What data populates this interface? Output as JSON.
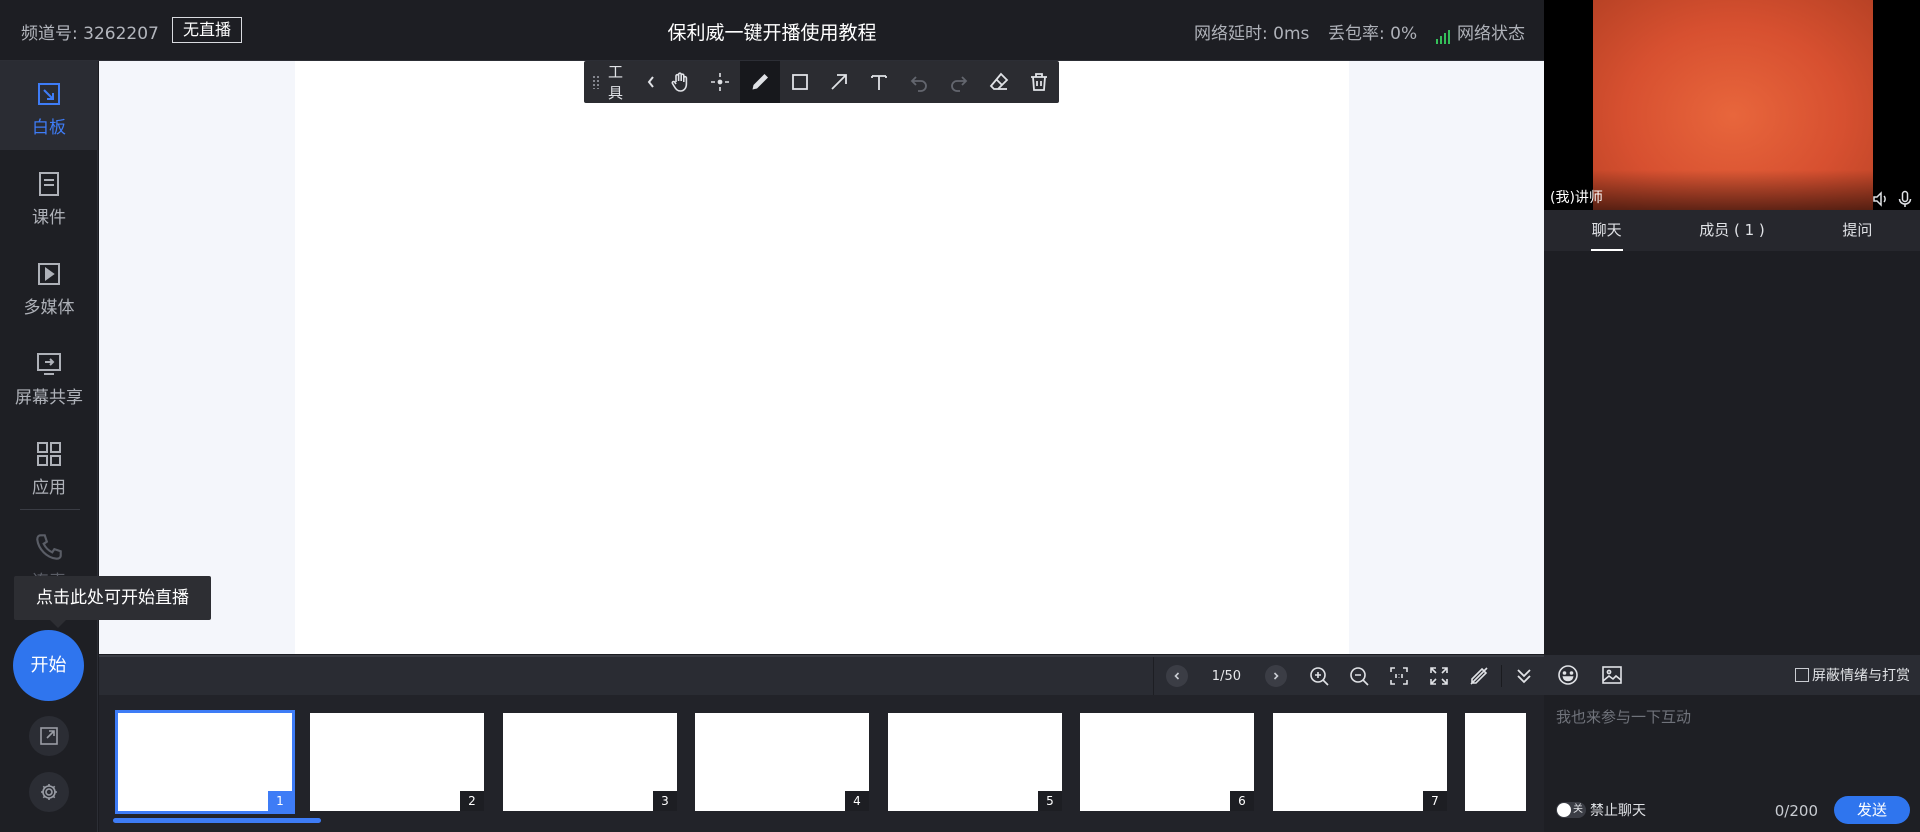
{
  "topbar": {
    "channel": "频道号: 3262207",
    "live_status": "无直播",
    "title": "保利威一键开播使用教程",
    "latency": "网络延时: 0ms",
    "packet_loss": "丢包率: 0%",
    "network_status": "网络状态"
  },
  "sidebar": {
    "items": [
      {
        "label": "白板",
        "icon": "whiteboard-icon"
      },
      {
        "label": "课件",
        "icon": "courseware-icon"
      },
      {
        "label": "多媒体",
        "icon": "multimedia-icon"
      },
      {
        "label": "屏幕共享",
        "icon": "screen-share-icon"
      },
      {
        "label": "应用",
        "icon": "apps-icon"
      }
    ],
    "lianmai": "连麦",
    "tooltip": "点击此处可开始直播",
    "start": "开始"
  },
  "toolbar": {
    "label": "工具",
    "tools": [
      "hand-icon",
      "laser-pointer-icon",
      "pen-icon",
      "rectangle-icon",
      "arrow-icon",
      "text-icon",
      "undo-icon",
      "redo-icon",
      "eraser-icon",
      "trash-icon"
    ]
  },
  "pagebar": {
    "page": "1/50"
  },
  "thumbnails": [
    "1",
    "2",
    "3",
    "4",
    "5",
    "6",
    "7"
  ],
  "video": {
    "name": "(我)讲师"
  },
  "tabs": [
    "聊天",
    "成员 ( 1 )",
    "提问"
  ],
  "chat": {
    "filter_label": "屏蔽情绪与打赏",
    "placeholder": "我也来参与一下互动",
    "toggle_text": "关",
    "mute_label": "禁止聊天",
    "count": "0/200",
    "send": "发送"
  },
  "colors": {
    "accent": "#3e7cf6",
    "start_button": "#2f75ee",
    "signal": "#35c05a"
  }
}
